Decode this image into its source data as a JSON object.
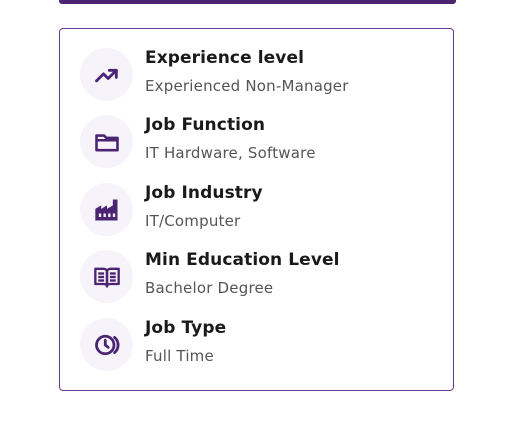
{
  "colors": {
    "accent": "#4b2473",
    "icon_bg": "#f7f3fa",
    "border": "#6a3b8f"
  },
  "job_details": [
    {
      "label": "Experience level",
      "value": "Experienced Non-Manager",
      "icon": "trending-up-icon"
    },
    {
      "label": "Job Function",
      "value": "IT Hardware, Software",
      "icon": "folder-icon"
    },
    {
      "label": "Job Industry",
      "value": "IT/Computer",
      "icon": "factory-icon"
    },
    {
      "label": "Min Education Level",
      "value": "Bachelor Degree",
      "icon": "book-icon"
    },
    {
      "label": "Job Type",
      "value": "Full Time",
      "icon": "clock-icon"
    }
  ]
}
